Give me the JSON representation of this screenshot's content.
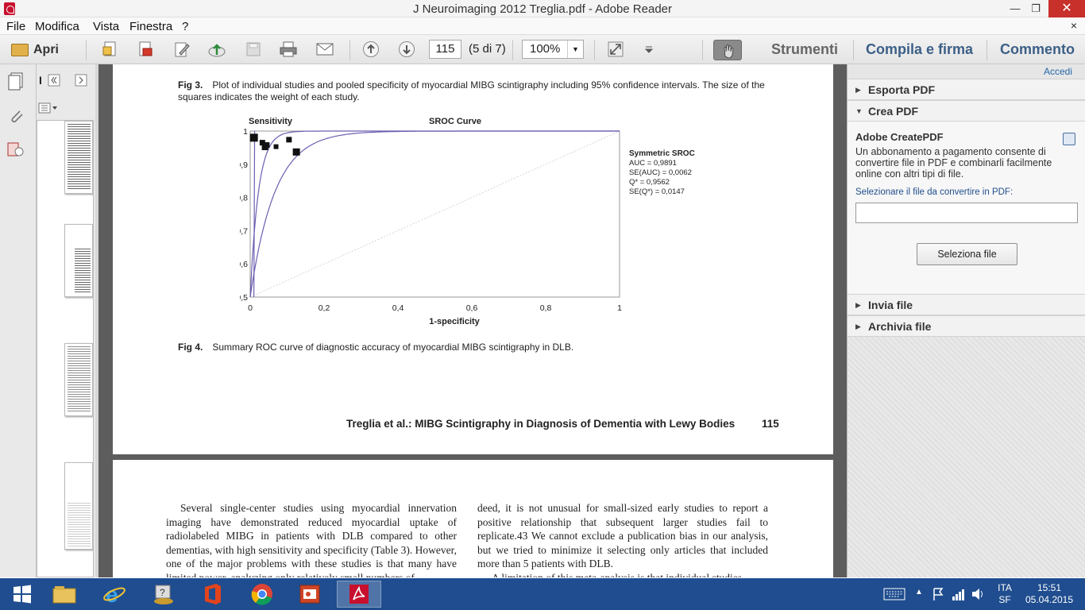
{
  "window": {
    "title": "J Neuroimaging 2012 Treglia.pdf - Adobe Reader"
  },
  "menu": {
    "items": [
      "File",
      "Modifica",
      "Vista",
      "Finestra",
      "?"
    ],
    "close": "×"
  },
  "toolbar": {
    "open_label": "Apri",
    "page_value": "115",
    "page_count": "(5 di 7)",
    "zoom_value": "100%",
    "tab_tools": "Strumenti",
    "tab_fill_sign": "Compila e firma",
    "tab_comment": "Commento"
  },
  "page1": {
    "fig3_label": "Fig 3.",
    "fig3_caption_line1": "Plot of individual studies and pooled specificity of myocardial MIBG scintigraphy including 95% confidence intervals. The size of the",
    "fig3_caption_line2": "squares indicates the weight of each study.",
    "fig4_label": "Fig 4.",
    "fig4_caption": "Summary ROC curve of diagnostic accuracy of myocardial MIBG scintigraphy in DLB.",
    "running_head": "Treglia et al.: MIBG Scintigraphy in Diagnosis of Dementia with Lewy Bodies",
    "page_number": "115"
  },
  "chart_data": {
    "type": "scatter",
    "title": "SROC Curve",
    "ylabel": "Sensitivity",
    "xlabel": "1-specificity",
    "xlim": [
      0,
      1
    ],
    "ylim": [
      0.5,
      1
    ],
    "x_ticks": [
      "0",
      "0,2",
      "0,4",
      "0,6",
      "0,8",
      "1"
    ],
    "y_ticks": [
      "1",
      "0,9",
      "0,8",
      "0,7",
      "0,6",
      "0,5"
    ],
    "points": [
      {
        "x": 0.01,
        "y": 0.98,
        "size": 10
      },
      {
        "x": 0.033,
        "y": 0.965,
        "size": 7
      },
      {
        "x": 0.04,
        "y": 0.952,
        "size": 8
      },
      {
        "x": 0.045,
        "y": 0.958,
        "size": 7
      },
      {
        "x": 0.07,
        "y": 0.953,
        "size": 6
      },
      {
        "x": 0.105,
        "y": 0.974,
        "size": 7
      },
      {
        "x": 0.125,
        "y": 0.937,
        "size": 9
      }
    ],
    "annotation_title": "Symmetric SROC",
    "annotation_lines": [
      "AUC = 0,9891",
      "SE(AUC) = 0,0062",
      "Q* = 0,9562",
      "SE(Q*) = 0,0147"
    ]
  },
  "page2": {
    "col1": "Several single-center studies using myocardial innervation imaging have demonstrated reduced myocardial uptake of radiolabeled MIBG in patients with DLB compared to other dementias, with high sensitivity and specificity (Table 3). However, one of the major problems with these studies is that many have limited power, analyzing only relatively small numbers of",
    "col2": "deed, it is not unusual for small-sized early studies to report a positive relationship that subsequent larger studies fail to replicate.43 We cannot exclude a publication bias in our analysis, but we tried to minimize it selecting only articles that included more than 5 patients with DLB.",
    "col2_next": "A limitation of this meta-analysis is that individual studies"
  },
  "toolpane": {
    "login": "Accedi",
    "export_pdf": "Esporta PDF",
    "create_pdf": "Crea PDF",
    "createpdf_title": "Adobe CreatePDF",
    "createpdf_desc": "Un abbonamento a pagamento consente di convertire file in PDF e combinarli facilmente online con altri tipi di file.",
    "select_label": "Selezionare il file da convertire in PDF:",
    "select_button": "Seleziona file",
    "send_files": "Invia file",
    "store_files": "Archivia file"
  },
  "taskbar": {
    "lang_top": "ITA",
    "lang_bottom": "SF",
    "time": "15:51",
    "date": "05.04.2015"
  },
  "colors": {
    "taskbar": "#1f4d8f",
    "accent_blue": "#3c5f86",
    "close_red": "#c7302b",
    "curve": "#6a5fb0"
  }
}
